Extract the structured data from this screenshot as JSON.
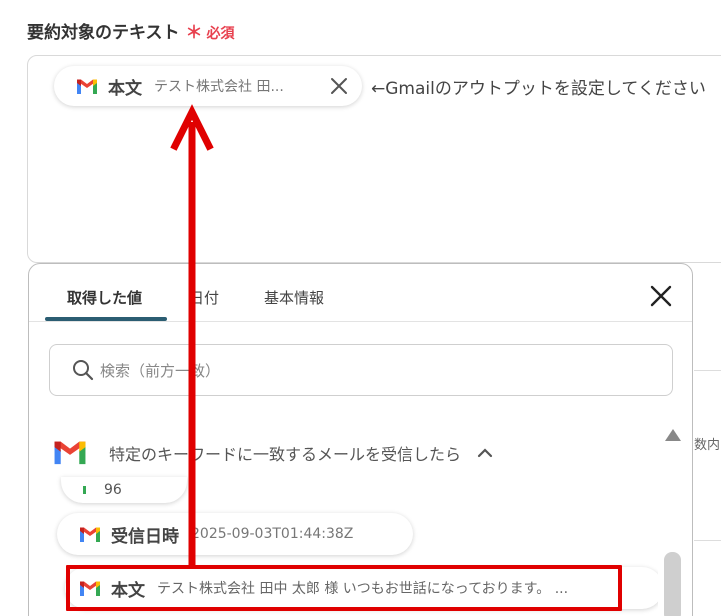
{
  "field": {
    "label": "要約対象のテキスト",
    "required_mark": "＊",
    "required_text": "必須"
  },
  "selected_chip": {
    "label": "本文",
    "value": "テスト株式会社 田..."
  },
  "hint": "←Gmailのアウトプットを設定してください",
  "panel": {
    "tabs": [
      "取得した値",
      "日付",
      "基本情報"
    ],
    "active_tab": 0,
    "search_placeholder": "検索（前方一致）",
    "group_title": "特定のキーワードに一致するメールを受信したら",
    "partial_item_text": "96",
    "items": [
      {
        "label": "受信日時",
        "value": "2025-09-03T01:44:38Z"
      },
      {
        "label": "本文",
        "value": "テスト株式会社 田中 太郎 様 いつもお世話になっております。 ..."
      }
    ]
  },
  "background": {
    "suffix": "数内"
  },
  "colors": {
    "required": "#e8414f",
    "tab_underline": "#2b5d72",
    "highlight": "#e00000"
  },
  "icons": [
    "gmail-icon",
    "close-icon",
    "search-icon",
    "chevron-up-icon",
    "scroll-up-icon"
  ]
}
